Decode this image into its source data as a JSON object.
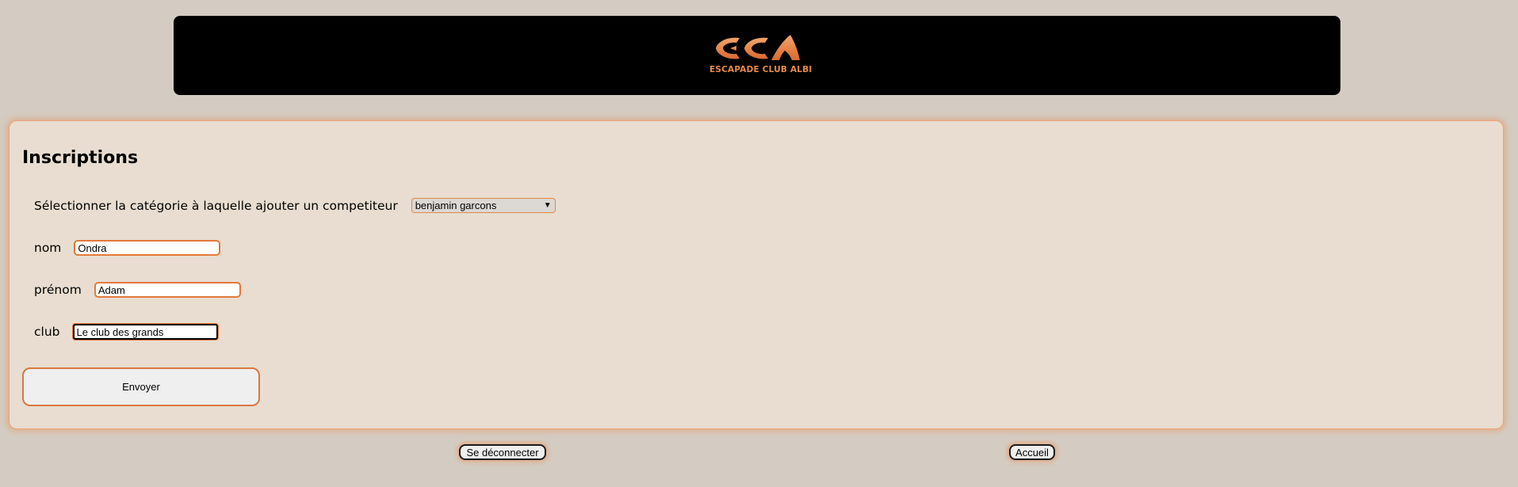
{
  "header": {
    "logo_text": "ESCAPADE CLUB ALBI"
  },
  "colors": {
    "accent": "#e98a4a",
    "background": "#d4ccc2",
    "panel": "#e8ddd0"
  },
  "form": {
    "title": "Inscriptions",
    "category_label": "Sélectionner la catégorie à laquelle ajouter un competiteur",
    "category_value": "benjamin garcons",
    "nom_label": "nom",
    "nom_value": "Ondra",
    "prenom_label": "prénom",
    "prenom_value": "Adam",
    "club_label": "club",
    "club_value": "Le club des grands",
    "submit_label": "Envoyer"
  },
  "footer": {
    "logout_label": "Se déconnecter",
    "home_label": "Accueil"
  }
}
